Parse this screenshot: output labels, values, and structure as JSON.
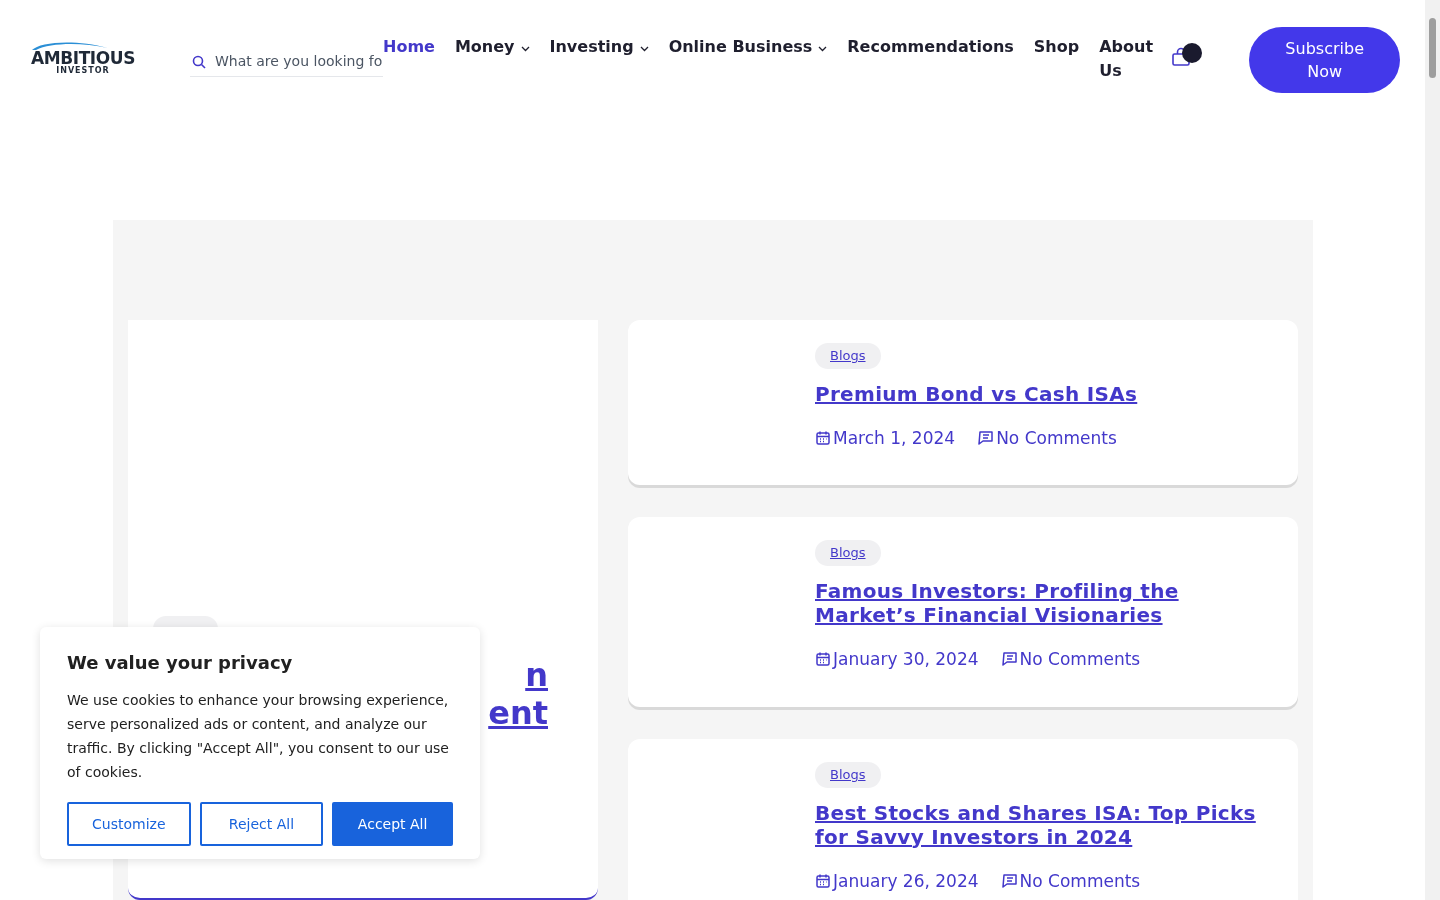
{
  "header": {
    "logo": {
      "name": "AMBITIOUS",
      "tagline": "INVESTOR"
    },
    "search": {
      "placeholder": "What are you looking fo"
    },
    "nav": [
      {
        "label": "Home",
        "selected": true,
        "has_menu": false
      },
      {
        "label": "Money",
        "selected": false,
        "has_menu": true
      },
      {
        "label": "Investing",
        "selected": false,
        "has_menu": true
      },
      {
        "label": "Online Business",
        "selected": false,
        "has_menu": true
      },
      {
        "label": "Recommendations",
        "selected": false,
        "has_menu": false
      },
      {
        "label": "Shop",
        "selected": false,
        "has_menu": false
      },
      {
        "label": "About Us",
        "selected": false,
        "has_menu": false
      }
    ],
    "subscribe": "Subscribe Now"
  },
  "featured": {
    "title_lines": [
      "n",
      "ent"
    ]
  },
  "posts": [
    {
      "tag": "Blogs",
      "title": "Premium Bond vs Cash ISAs",
      "date": "March 1, 2024",
      "comments": "No Comments"
    },
    {
      "tag": "Blogs",
      "title": "Famous Investors: Profiling the Market’s Financial Visionaries",
      "date": "January 30, 2024",
      "comments": "No Comments"
    },
    {
      "tag": "Blogs",
      "title": "Best Stocks and Shares ISA: Top Picks for Savvy Investors in 2024",
      "date": "January 26, 2024",
      "comments": "No Comments"
    }
  ],
  "cookie_banner": {
    "title": "We value your privacy",
    "text": "We use cookies to enhance your browsing experience, serve personalized ads or content, and analyze our traffic. By clicking \"Accept All\", you consent to our use of cookies.",
    "buttons": [
      {
        "label": "Customize",
        "kind": "outline"
      },
      {
        "label": "Reject All",
        "kind": "outline"
      },
      {
        "label": "Accept All",
        "kind": "primary"
      }
    ]
  }
}
